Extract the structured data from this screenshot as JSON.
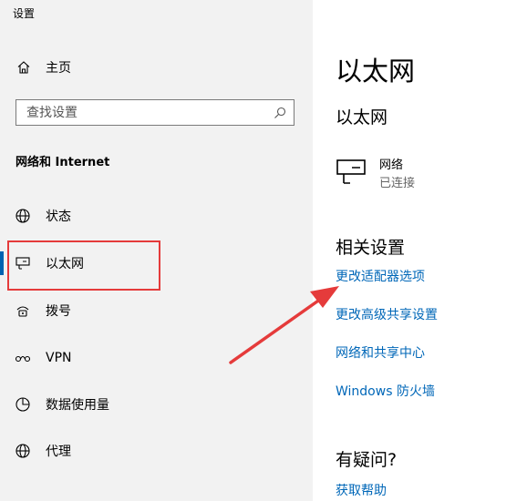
{
  "window": {
    "title": "设置"
  },
  "sidebar": {
    "home_label": "主页",
    "search": {
      "placeholder": "查找设置"
    },
    "section_title": "网络和 Internet",
    "items": [
      {
        "label": "状态",
        "icon": "status-globe-icon"
      },
      {
        "label": "以太网",
        "icon": "ethernet-icon"
      },
      {
        "label": "拨号",
        "icon": "dialup-icon"
      },
      {
        "label": "VPN",
        "icon": "vpn-icon"
      },
      {
        "label": "数据使用量",
        "icon": "data-usage-icon"
      },
      {
        "label": "代理",
        "icon": "proxy-globe-icon"
      }
    ]
  },
  "main": {
    "title": "以太网",
    "subheading": "以太网",
    "network": {
      "name": "网络",
      "status": "已连接",
      "icon": "ethernet-icon"
    },
    "related_title": "相关设置",
    "links": [
      "更改适配器选项",
      "更改高级共享设置",
      "网络和共享中心",
      "Windows 防火墙"
    ],
    "question_title": "有疑问?",
    "help_link": "获取帮助"
  },
  "colors": {
    "sidebar_bg": "#f2f2f2",
    "accent": "#0063b1",
    "link": "#0067b8",
    "annotation_red": "#e53b3b"
  }
}
